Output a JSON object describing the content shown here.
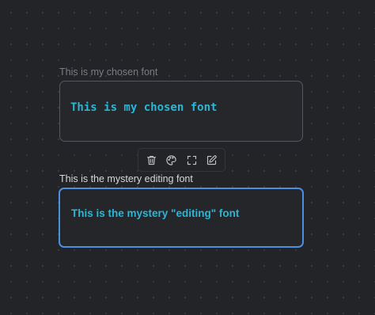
{
  "nodes": [
    {
      "label": "This is my chosen font",
      "text": "This is my chosen font",
      "selected": false
    },
    {
      "label": "This is the mystery editing font",
      "text": "This is the mystery \"editing\" font",
      "selected": true
    }
  ],
  "toolbar": {
    "buttons": [
      {
        "icon": "trash-icon",
        "action": "delete"
      },
      {
        "icon": "palette-icon",
        "action": "set-color"
      },
      {
        "icon": "zoom-to-fit-icon",
        "action": "zoom-to-selection"
      },
      {
        "icon": "edit-icon",
        "action": "edit"
      }
    ]
  },
  "colors": {
    "canvas_background": "#232427",
    "grid_dot": "#3a3b40",
    "node_text": "#2ab7d6",
    "node_border": "#55575e",
    "selected_border": "#4a8fe0",
    "label_muted": "#7a7c83",
    "label_active": "#d6d7da"
  }
}
